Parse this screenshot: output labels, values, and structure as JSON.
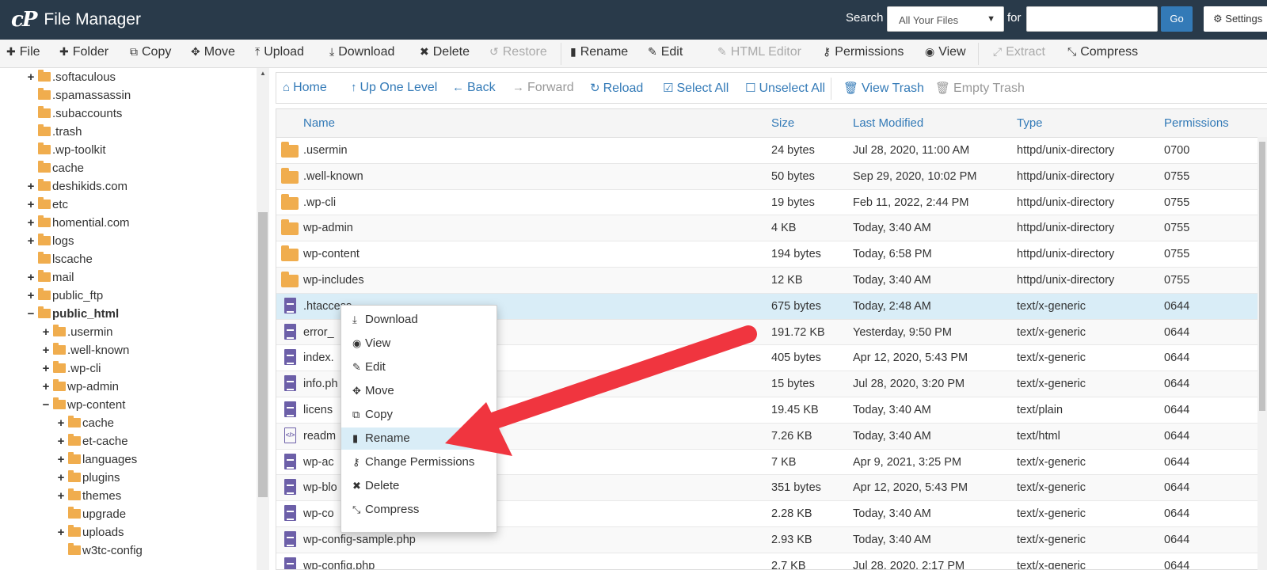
{
  "app": {
    "logo": "cP",
    "title": "File Manager"
  },
  "search": {
    "label": "Search",
    "scope": "All Your Files",
    "for_label": "for",
    "value": "",
    "go": "Go",
    "settings": "Settings"
  },
  "toolbar": [
    {
      "label": "File",
      "icon": "plus-icon",
      "glyph": "✚",
      "disabled": false
    },
    {
      "label": "Folder",
      "icon": "plus-icon",
      "glyph": "✚",
      "disabled": false
    },
    {
      "label": "Copy",
      "icon": "copy-icon",
      "glyph": "⧉",
      "disabled": false
    },
    {
      "label": "Move",
      "icon": "move-icon",
      "glyph": "✥",
      "disabled": false
    },
    {
      "label": "Upload",
      "icon": "upload-icon",
      "glyph": "⤒",
      "disabled": false
    },
    {
      "label": "Download",
      "icon": "download-icon",
      "glyph": "⤓",
      "disabled": false
    },
    {
      "label": "Delete",
      "icon": "close-icon",
      "glyph": "✖",
      "disabled": false
    },
    {
      "label": "Restore",
      "icon": "undo-icon",
      "glyph": "↺",
      "disabled": true
    },
    {
      "label": "Rename",
      "icon": "file-icon",
      "glyph": "▮",
      "disabled": false
    },
    {
      "label": "Edit",
      "icon": "pencil-icon",
      "glyph": "✎",
      "disabled": false
    },
    {
      "label": "HTML Editor",
      "icon": "edit-icon",
      "glyph": "✎",
      "disabled": true
    },
    {
      "label": "Permissions",
      "icon": "key-icon",
      "glyph": "⚷",
      "disabled": false
    },
    {
      "label": "View",
      "icon": "eye-icon",
      "glyph": "◉",
      "disabled": false
    },
    {
      "label": "Extract",
      "icon": "expand-icon",
      "glyph": "⤢",
      "disabled": true
    },
    {
      "label": "Compress",
      "icon": "compress-icon",
      "glyph": "⤡",
      "disabled": false
    }
  ],
  "tree": [
    {
      "label": ".softaculous",
      "toggle": "+",
      "depth": 1,
      "bold": false
    },
    {
      "label": ".spamassassin",
      "toggle": "",
      "depth": 1,
      "bold": false
    },
    {
      "label": ".subaccounts",
      "toggle": "",
      "depth": 1,
      "bold": false
    },
    {
      "label": ".trash",
      "toggle": "",
      "depth": 1,
      "bold": false
    },
    {
      "label": ".wp-toolkit",
      "toggle": "",
      "depth": 1,
      "bold": false
    },
    {
      "label": "cache",
      "toggle": "",
      "depth": 1,
      "bold": false
    },
    {
      "label": "deshikids.com",
      "toggle": "+",
      "depth": 1,
      "bold": false
    },
    {
      "label": "etc",
      "toggle": "+",
      "depth": 1,
      "bold": false
    },
    {
      "label": "homential.com",
      "toggle": "+",
      "depth": 1,
      "bold": false
    },
    {
      "label": "logs",
      "toggle": "+",
      "depth": 1,
      "bold": false
    },
    {
      "label": "lscache",
      "toggle": "",
      "depth": 1,
      "bold": false
    },
    {
      "label": "mail",
      "toggle": "+",
      "depth": 1,
      "bold": false
    },
    {
      "label": "public_ftp",
      "toggle": "+",
      "depth": 1,
      "bold": false
    },
    {
      "label": "public_html",
      "toggle": "−",
      "depth": 1,
      "bold": true
    },
    {
      "label": ".usermin",
      "toggle": "+",
      "depth": 2,
      "bold": false
    },
    {
      "label": ".well-known",
      "toggle": "+",
      "depth": 2,
      "bold": false
    },
    {
      "label": ".wp-cli",
      "toggle": "+",
      "depth": 2,
      "bold": false
    },
    {
      "label": "wp-admin",
      "toggle": "+",
      "depth": 2,
      "bold": false
    },
    {
      "label": "wp-content",
      "toggle": "−",
      "depth": 2,
      "bold": false
    },
    {
      "label": "cache",
      "toggle": "+",
      "depth": 3,
      "bold": false
    },
    {
      "label": "et-cache",
      "toggle": "+",
      "depth": 3,
      "bold": false
    },
    {
      "label": "languages",
      "toggle": "+",
      "depth": 3,
      "bold": false
    },
    {
      "label": "plugins",
      "toggle": "+",
      "depth": 3,
      "bold": false
    },
    {
      "label": "themes",
      "toggle": "+",
      "depth": 3,
      "bold": false
    },
    {
      "label": "upgrade",
      "toggle": "",
      "depth": 3,
      "bold": false
    },
    {
      "label": "uploads",
      "toggle": "+",
      "depth": 3,
      "bold": false
    },
    {
      "label": "w3tc-config",
      "toggle": "",
      "depth": 3,
      "bold": false
    }
  ],
  "nav": [
    {
      "label": "Home",
      "icon": "home-icon",
      "glyph": "⌂",
      "disabled": false
    },
    {
      "label": "Up One Level",
      "icon": "arrow-up-icon",
      "glyph": "↑",
      "disabled": false
    },
    {
      "label": "Back",
      "icon": "arrow-left-icon",
      "glyph": "←",
      "disabled": false
    },
    {
      "label": "Forward",
      "icon": "arrow-right-icon",
      "glyph": "→",
      "disabled": true
    },
    {
      "label": "Reload",
      "icon": "reload-icon",
      "glyph": "↻",
      "disabled": false
    },
    {
      "label": "Select All",
      "icon": "checkbox-checked-icon",
      "glyph": "☑",
      "disabled": false
    },
    {
      "label": "Unselect All",
      "icon": "checkbox-empty-icon",
      "glyph": "☐",
      "disabled": false
    },
    {
      "label": "View Trash",
      "icon": "trash-icon",
      "glyph": "🗑",
      "disabled": false
    },
    {
      "label": "Empty Trash",
      "icon": "trash-icon",
      "glyph": "🗑",
      "disabled": true
    }
  ],
  "columns": [
    "Name",
    "Size",
    "Last Modified",
    "Type",
    "Permissions"
  ],
  "files": [
    {
      "name": ".usermin",
      "size": "24 bytes",
      "modified": "Jul 28, 2020, 11:00 AM",
      "type": "httpd/unix-directory",
      "perms": "0700",
      "kind": "folder"
    },
    {
      "name": ".well-known",
      "size": "50 bytes",
      "modified": "Sep 29, 2020, 10:02 PM",
      "type": "httpd/unix-directory",
      "perms": "0755",
      "kind": "folder"
    },
    {
      "name": ".wp-cli",
      "size": "19 bytes",
      "modified": "Feb 11, 2022, 2:44 PM",
      "type": "httpd/unix-directory",
      "perms": "0755",
      "kind": "folder"
    },
    {
      "name": "wp-admin",
      "size": "4 KB",
      "modified": "Today, 3:40 AM",
      "type": "httpd/unix-directory",
      "perms": "0755",
      "kind": "folder"
    },
    {
      "name": "wp-content",
      "size": "194 bytes",
      "modified": "Today, 6:58 PM",
      "type": "httpd/unix-directory",
      "perms": "0755",
      "kind": "folder"
    },
    {
      "name": "wp-includes",
      "size": "12 KB",
      "modified": "Today, 3:40 AM",
      "type": "httpd/unix-directory",
      "perms": "0755",
      "kind": "folder"
    },
    {
      "name": ".htaccess",
      "size": "675 bytes",
      "modified": "Today, 2:48 AM",
      "type": "text/x-generic",
      "perms": "0644",
      "kind": "file",
      "selected": true
    },
    {
      "name": "error_",
      "size": "191.72 KB",
      "modified": "Yesterday, 9:50 PM",
      "type": "text/x-generic",
      "perms": "0644",
      "kind": "file"
    },
    {
      "name": "index.",
      "size": "405 bytes",
      "modified": "Apr 12, 2020, 5:43 PM",
      "type": "text/x-generic",
      "perms": "0644",
      "kind": "file"
    },
    {
      "name": "info.ph",
      "size": "15 bytes",
      "modified": "Jul 28, 2020, 3:20 PM",
      "type": "text/x-generic",
      "perms": "0644",
      "kind": "file"
    },
    {
      "name": "licens",
      "size": "19.45 KB",
      "modified": "Today, 3:40 AM",
      "type": "text/plain",
      "perms": "0644",
      "kind": "file"
    },
    {
      "name": "readm",
      "size": "7.26 KB",
      "modified": "Today, 3:40 AM",
      "type": "text/html",
      "perms": "0644",
      "kind": "html"
    },
    {
      "name": "wp-ac",
      "size": "7 KB",
      "modified": "Apr 9, 2021, 3:25 PM",
      "type": "text/x-generic",
      "perms": "0644",
      "kind": "file"
    },
    {
      "name": "wp-blo",
      "size": "351 bytes",
      "modified": "Apr 12, 2020, 5:43 PM",
      "type": "text/x-generic",
      "perms": "0644",
      "kind": "file"
    },
    {
      "name": "wp-co",
      "size": "2.28 KB",
      "modified": "Today, 3:40 AM",
      "type": "text/x-generic",
      "perms": "0644",
      "kind": "file"
    },
    {
      "name": "wp-config-sample.php",
      "size": "2.93 KB",
      "modified": "Today, 3:40 AM",
      "type": "text/x-generic",
      "perms": "0644",
      "kind": "file"
    },
    {
      "name": "wp-config.php",
      "size": "2.7 KB",
      "modified": "Jul 28, 2020, 2:17 PM",
      "type": "text/x-generic",
      "perms": "0644",
      "kind": "file"
    }
  ],
  "context_menu": [
    {
      "label": "Download",
      "icon": "download-icon",
      "glyph": "⤓",
      "active": false
    },
    {
      "label": "View",
      "icon": "eye-icon",
      "glyph": "◉",
      "active": false
    },
    {
      "label": "Edit",
      "icon": "pencil-icon",
      "glyph": "✎",
      "active": false
    },
    {
      "label": "Move",
      "icon": "move-icon",
      "glyph": "✥",
      "active": false
    },
    {
      "label": "Copy",
      "icon": "copy-icon",
      "glyph": "⧉",
      "active": false
    },
    {
      "label": "Rename",
      "icon": "file-icon",
      "glyph": "▮",
      "active": true
    },
    {
      "label": "Change Permissions",
      "icon": "key-icon",
      "glyph": "⚷",
      "active": false
    },
    {
      "label": "Delete",
      "icon": "close-icon",
      "glyph": "✖",
      "active": false
    },
    {
      "label": "Compress",
      "icon": "compress-icon",
      "glyph": "⤡",
      "active": false
    }
  ],
  "colors": {
    "header": "#293a4a",
    "link": "#337ab7",
    "folder": "#f0ad4e",
    "file": "#6c5fa8",
    "selected": "#d9edf7",
    "arrow": "#f0353f"
  }
}
